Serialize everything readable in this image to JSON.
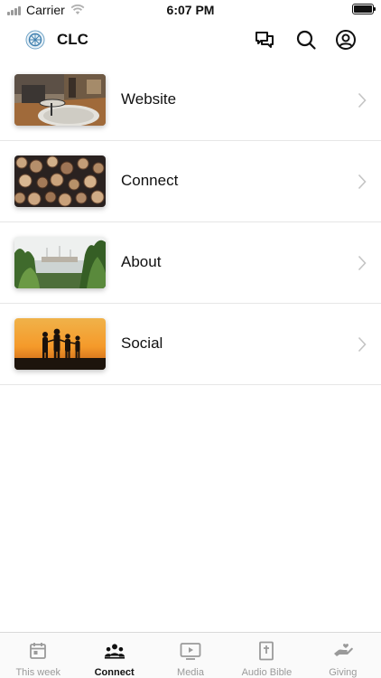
{
  "status_bar": {
    "carrier": "Carrier",
    "time": "6:07 PM"
  },
  "header": {
    "title": "CLC"
  },
  "menu": {
    "items": [
      {
        "label": "Website",
        "image": "living-room-photo"
      },
      {
        "label": "Connect",
        "image": "log-pile-photo"
      },
      {
        "label": "About",
        "image": "harbor-photo"
      },
      {
        "label": "Social",
        "image": "sunset-family-photo"
      }
    ]
  },
  "tabs": [
    {
      "label": "This week",
      "icon": "calendar-icon",
      "active": false
    },
    {
      "label": "Connect",
      "icon": "group-icon",
      "active": true
    },
    {
      "label": "Media",
      "icon": "play-screen-icon",
      "active": false
    },
    {
      "label": "Audio Bible",
      "icon": "bible-icon",
      "active": false
    },
    {
      "label": "Giving",
      "icon": "giving-hand-icon",
      "active": false
    }
  ],
  "colors": {
    "accent": "#111111",
    "inactive": "#9a9a9a",
    "divider": "#e6e6e6"
  }
}
